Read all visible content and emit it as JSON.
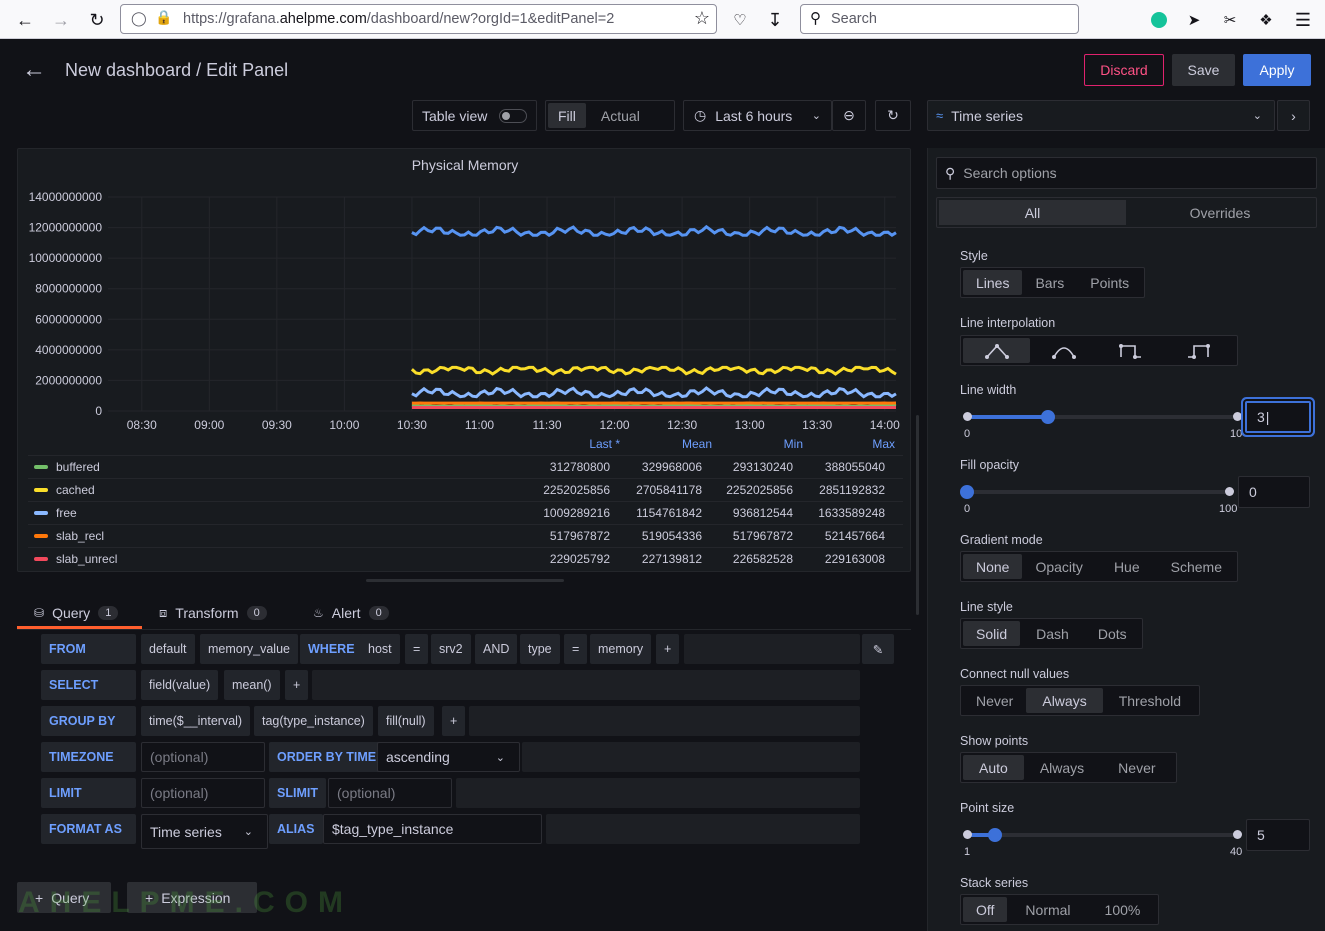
{
  "browser": {
    "url_prefix": "https://grafana.",
    "url_domain": "ahelpme.com",
    "url_suffix": "/dashboard/new?orgId=1&editPanel=2",
    "search_placeholder": "Search"
  },
  "header": {
    "title": "New dashboard / Edit Panel",
    "discard_label": "Discard",
    "save_label": "Save",
    "apply_label": "Apply"
  },
  "toolbar": {
    "table_view_label": "Table view",
    "fill_label": "Fill",
    "actual_label": "Actual",
    "time_range_label": "Last 6 hours",
    "visualization_label": "Time series"
  },
  "chart_data": {
    "type": "line",
    "title": "Physical Memory",
    "ylim": [
      0,
      14000000000
    ],
    "y_ticks": [
      "14000000000",
      "12000000000",
      "10000000000",
      "8000000000",
      "6000000000",
      "4000000000",
      "2000000000",
      "0"
    ],
    "x_ticks": [
      "08:30",
      "09:00",
      "09:30",
      "10:00",
      "10:30",
      "11:00",
      "11:30",
      "12:00",
      "12:30",
      "13:00",
      "13:30",
      "14:00"
    ],
    "grid": true,
    "series": [
      {
        "name": "buffered",
        "color": "#73bf69",
        "values": [
          312780800,
          329968006,
          293130240,
          388055040
        ]
      },
      {
        "name": "cached",
        "color": "#fade2a",
        "values": [
          2252025856,
          2705841178,
          2252025856,
          2851192832
        ]
      },
      {
        "name": "free",
        "color": "#8ab8ff",
        "values": [
          1009289216,
          1154761842,
          936812544,
          1633589248
        ]
      },
      {
        "name": "slab_recl",
        "color": "#ff780a",
        "values": [
          517967872,
          519054336,
          517967872,
          521457664
        ]
      },
      {
        "name": "slab_unrecl",
        "color": "#f2495c",
        "values": [
          229025792,
          227139812,
          226582528,
          229163008
        ]
      }
    ],
    "unnamed_series": [
      {
        "color": "#5794f2",
        "level": 11700000000
      }
    ]
  },
  "legend": {
    "headers": [
      "Last *",
      "Mean",
      "Min",
      "Max"
    ],
    "rows": [
      {
        "name": "buffered",
        "color": "#73bf69",
        "vals": [
          "312780800",
          "329968006",
          "293130240",
          "388055040"
        ]
      },
      {
        "name": "cached",
        "color": "#fade2a",
        "vals": [
          "2252025856",
          "2705841178",
          "2252025856",
          "2851192832"
        ]
      },
      {
        "name": "free",
        "color": "#8ab8ff",
        "vals": [
          "1009289216",
          "1154761842",
          "936812544",
          "1633589248"
        ]
      },
      {
        "name": "slab_recl",
        "color": "#ff780a",
        "vals": [
          "517967872",
          "519054336",
          "517967872",
          "521457664"
        ]
      },
      {
        "name": "slab_unrecl",
        "color": "#f2495c",
        "vals": [
          "229025792",
          "227139812",
          "226582528",
          "229163008"
        ]
      }
    ]
  },
  "tabs": {
    "query_label": "Query",
    "query_count": "1",
    "transform_label": "Transform",
    "transform_count": "0",
    "alert_label": "Alert",
    "alert_count": "0"
  },
  "query": {
    "from_kw": "FROM",
    "from_db": "default",
    "from_measurement": "memory_value",
    "where_kw": "WHERE",
    "where_key1": "host",
    "where_op1": "=",
    "where_val1": "srv2",
    "and_kw": "AND",
    "where_key2": "type",
    "where_op2": "=",
    "where_val2": "memory",
    "plus": "+",
    "select_kw": "SELECT",
    "select_field": "field(value)",
    "select_fn": "mean()",
    "groupby_kw": "GROUP BY",
    "group_time": "time($__interval)",
    "group_tag": "tag(type_instance)",
    "group_fill": "fill(null)",
    "timezone_kw": "TIMEZONE",
    "optional": "(optional)",
    "orderby_kw": "ORDER BY TIME",
    "order_value": "ascending",
    "limit_kw": "LIMIT",
    "slimit_kw": "SLIMIT",
    "format_kw": "FORMAT AS",
    "format_value": "Time series",
    "alias_kw": "ALIAS",
    "alias_value": "$tag_type_instance",
    "add_query_label": "Query",
    "add_expression_label": "Expression"
  },
  "options": {
    "search_placeholder": "Search options",
    "tab_all": "All",
    "tab_overrides": "Overrides",
    "style_label": "Style",
    "style_opts": [
      "Lines",
      "Bars",
      "Points"
    ],
    "interp_label": "Line interpolation",
    "line_width_label": "Line width",
    "line_width_value": "3",
    "line_width_min": "0",
    "line_width_max": "10",
    "line_width_level": 0.3,
    "fill_opacity_label": "Fill opacity",
    "fill_opacity_value": "0",
    "fill_opacity_min": "0",
    "fill_opacity_max": "100",
    "fill_opacity_level": 0,
    "gradient_label": "Gradient mode",
    "gradient_opts": [
      "None",
      "Opacity",
      "Hue",
      "Scheme"
    ],
    "line_style_label": "Line style",
    "line_style_opts": [
      "Solid",
      "Dash",
      "Dots"
    ],
    "connect_label": "Connect null values",
    "connect_opts": [
      "Never",
      "Always",
      "Threshold"
    ],
    "show_points_label": "Show points",
    "show_points_opts": [
      "Auto",
      "Always",
      "Never"
    ],
    "point_size_label": "Point size",
    "point_size_value": "5",
    "point_size_min": "1",
    "point_size_max": "40",
    "point_size_level": 0.103,
    "stack_label": "Stack series",
    "stack_opts": [
      "Off",
      "Normal",
      "100%"
    ]
  },
  "watermark": "AHELPME.COM"
}
